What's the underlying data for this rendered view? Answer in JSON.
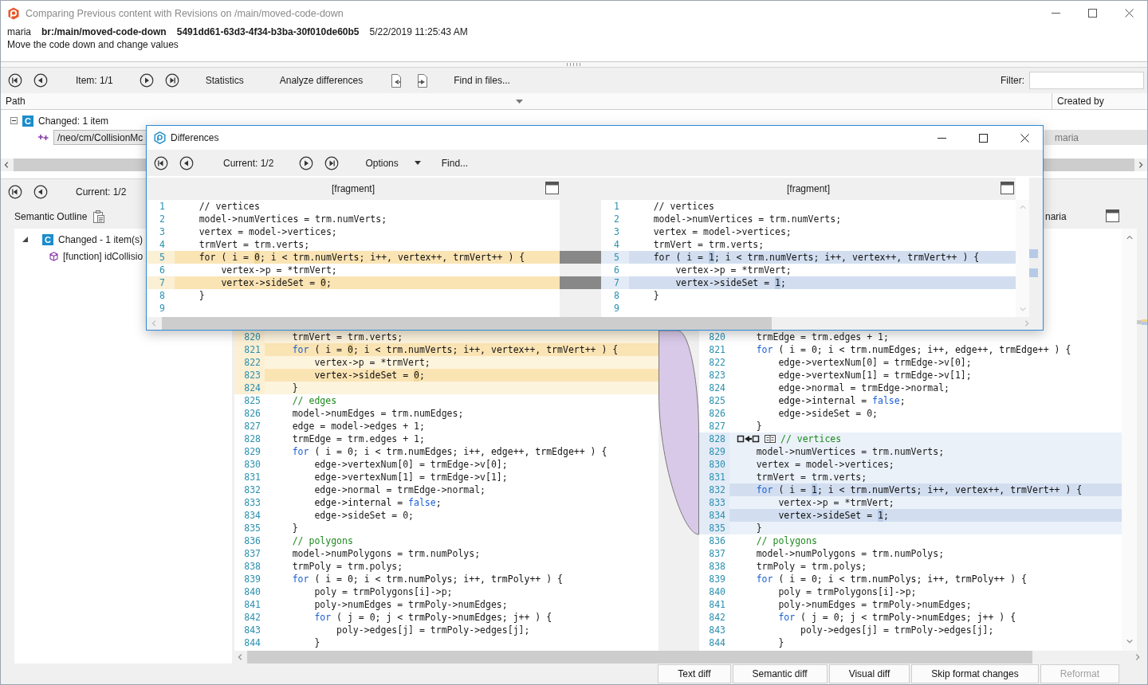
{
  "window": {
    "title": "Comparing Previous content with Revisions on /main/moved-code-down"
  },
  "changeset": {
    "author": "maria",
    "branch": "br:/main/moved-code-down",
    "id": "5491dd61-63d3-4f34-b3ba-30f010de60b5",
    "date": "5/22/2019 11:25:43 AM",
    "comment": "Move the code down and change values"
  },
  "toolbar": {
    "counter": "Item: 1/1",
    "statistics": "Statistics",
    "analyze": "Analyze differences",
    "find": "Find in files...",
    "filter_label": "Filter:"
  },
  "items_table": {
    "columns": [
      "Path",
      "Created by"
    ],
    "groups": [
      {
        "label": "Changed: 1 item",
        "badge": "C",
        "expanded": true,
        "rows": [
          {
            "path": "/neo/cm/CollisionMc",
            "created_by": "maria",
            "selected": true
          }
        ]
      }
    ]
  },
  "diff_toolbar": {
    "counter": "Current: 1/2"
  },
  "semantic_outline": {
    "title": "Semantic Outline",
    "tree": [
      {
        "label": "Changed - 1 item(s)",
        "badge": "C",
        "expanded": true,
        "children": [
          {
            "label": "[function] idCollisio"
          }
        ]
      }
    ]
  },
  "main_diff": {
    "right_header": "naria",
    "panes": [
      {
        "kind": "base",
        "lines": [
          {
            "number": "820",
            "in_block": true,
            "changed": false,
            "text": "    trmVert = trm.verts;"
          },
          {
            "number": "821",
            "in_block": true,
            "changed": true,
            "parts": [
              {
                "text": "    for",
                "kind": "keyword"
              },
              {
                "text": " ( i = ",
                "kind": "code"
              },
              {
                "text": "0",
                "kind": "change"
              },
              {
                "text": "; i < trm.numVerts; i++, vertex++, trmVert++ ) {",
                "kind": "code"
              }
            ]
          },
          {
            "number": "822",
            "in_block": true,
            "changed": false,
            "text": "        vertex->p = *trmVert;"
          },
          {
            "number": "823",
            "in_block": true,
            "changed": true,
            "parts": [
              {
                "text": "        vertex->sideSet = ",
                "kind": "code"
              },
              {
                "text": "0",
                "kind": "change"
              },
              {
                "text": ";",
                "kind": "code"
              }
            ]
          },
          {
            "number": "824",
            "in_block": true,
            "changed": false,
            "text": "    }"
          },
          {
            "number": "825",
            "in_block": false,
            "changed": false,
            "parts": [
              {
                "text": "    // edges",
                "kind": "comment"
              }
            ]
          },
          {
            "number": "826",
            "in_block": false,
            "changed": false,
            "text": "    model->numEdges = trm.numEdges;"
          },
          {
            "number": "827",
            "in_block": false,
            "changed": false,
            "text": "    edge = model->edges + 1;"
          },
          {
            "number": "828",
            "in_block": false,
            "changed": false,
            "text": "    trmEdge = trm.edges + 1;"
          },
          {
            "number": "829",
            "in_block": false,
            "changed": false,
            "parts": [
              {
                "text": "    for",
                "kind": "keyword"
              },
              {
                "text": " ( i = 0; i < trm.numEdges; i++, edge++, trmEdge++ ) {",
                "kind": "code"
              }
            ]
          },
          {
            "number": "830",
            "in_block": false,
            "changed": false,
            "text": "        edge->vertexNum[0] = trmEdge->v[0];"
          },
          {
            "number": "831",
            "in_block": false,
            "changed": false,
            "text": "        edge->vertexNum[1] = trmEdge->v[1];"
          },
          {
            "number": "832",
            "in_block": false,
            "changed": false,
            "text": "        edge->normal = trmEdge->normal;"
          },
          {
            "number": "833",
            "in_block": false,
            "changed": false,
            "parts": [
              {
                "text": "        edge->internal = ",
                "kind": "code"
              },
              {
                "text": "false",
                "kind": "keyword"
              },
              {
                "text": ";",
                "kind": "code"
              }
            ]
          },
          {
            "number": "834",
            "in_block": false,
            "changed": false,
            "text": "        edge->sideSet = 0;"
          },
          {
            "number": "835",
            "in_block": false,
            "changed": false,
            "text": "    }"
          },
          {
            "number": "836",
            "in_block": false,
            "changed": false,
            "parts": [
              {
                "text": "    // polygons",
                "kind": "comment"
              }
            ]
          },
          {
            "number": "837",
            "in_block": false,
            "changed": false,
            "text": "    model->numPolygons = trm.numPolys;"
          },
          {
            "number": "838",
            "in_block": false,
            "changed": false,
            "text": "    trmPoly = trm.polys;"
          },
          {
            "number": "839",
            "in_block": false,
            "changed": false,
            "parts": [
              {
                "text": "    for",
                "kind": "keyword"
              },
              {
                "text": " ( i = 0; i < trm.numPolys; i++, trmPoly++ ) {",
                "kind": "code"
              }
            ]
          },
          {
            "number": "840",
            "in_block": false,
            "changed": false,
            "text": "        poly = trmPolygons[i]->p;"
          },
          {
            "number": "841",
            "in_block": false,
            "changed": false,
            "text": "        poly->numEdges = trmPoly->numEdges;"
          },
          {
            "number": "842",
            "in_block": false,
            "changed": false,
            "parts": [
              {
                "text": "        for",
                "kind": "keyword"
              },
              {
                "text": " ( j = 0; j < trmPoly->numEdges; j++ ) {",
                "kind": "code"
              }
            ]
          },
          {
            "number": "843",
            "in_block": false,
            "changed": false,
            "text": "            poly->edges[j] = trmPoly->edges[j];"
          },
          {
            "number": "844",
            "in_block": false,
            "changed": false,
            "text": "        }"
          }
        ]
      },
      {
        "kind": "revision",
        "lines": [
          {
            "number": "820",
            "in_block": false,
            "changed": false,
            "text": "    trmEdge = trm.edges + 1;"
          },
          {
            "number": "821",
            "in_block": false,
            "changed": false,
            "parts": [
              {
                "text": "    for",
                "kind": "keyword"
              },
              {
                "text": " ( i = 0; i < trm.numEdges; i++, edge++, trmEdge++ ) {",
                "kind": "code"
              }
            ]
          },
          {
            "number": "822",
            "in_block": false,
            "changed": false,
            "text": "        edge->vertexNum[0] = trmEdge->v[0];"
          },
          {
            "number": "823",
            "in_block": false,
            "changed": false,
            "text": "        edge->vertexNum[1] = trmEdge->v[1];"
          },
          {
            "number": "824",
            "in_block": false,
            "changed": false,
            "text": "        edge->normal = trmEdge->normal;"
          },
          {
            "number": "825",
            "in_block": false,
            "changed": false,
            "parts": [
              {
                "text": "        edge->internal = ",
                "kind": "code"
              },
              {
                "text": "false",
                "kind": "keyword"
              },
              {
                "text": ";",
                "kind": "code"
              }
            ]
          },
          {
            "number": "826",
            "in_block": false,
            "changed": false,
            "text": "        edge->sideSet = 0;"
          },
          {
            "number": "827",
            "in_block": false,
            "changed": false,
            "text": "    }"
          },
          {
            "number": "828",
            "in_block": true,
            "changed": false,
            "moved_marker": true,
            "parts": [
              {
                "text": "// vertices",
                "kind": "comment"
              }
            ]
          },
          {
            "number": "829",
            "in_block": true,
            "changed": false,
            "text": "    model->numVertices = trm.numVerts;"
          },
          {
            "number": "830",
            "in_block": true,
            "changed": false,
            "text": "    vertex = model->vertices;"
          },
          {
            "number": "831",
            "in_block": true,
            "changed": false,
            "text": "    trmVert = trm.verts;"
          },
          {
            "number": "832",
            "in_block": true,
            "changed": true,
            "parts": [
              {
                "text": "    for",
                "kind": "keyword"
              },
              {
                "text": " ( i = ",
                "kind": "code"
              },
              {
                "text": "1",
                "kind": "change"
              },
              {
                "text": "; i < trm.numVerts; i++, vertex++, trmVert++ ) {",
                "kind": "code"
              }
            ]
          },
          {
            "number": "833",
            "in_block": true,
            "changed": false,
            "text": "        vertex->p = *trmVert;"
          },
          {
            "number": "834",
            "in_block": true,
            "changed": true,
            "parts": [
              {
                "text": "        vertex->sideSet = ",
                "kind": "code"
              },
              {
                "text": "1",
                "kind": "change"
              },
              {
                "text": ";",
                "kind": "code"
              }
            ]
          },
          {
            "number": "835",
            "in_block": true,
            "changed": false,
            "text": "    }"
          },
          {
            "number": "836",
            "in_block": false,
            "changed": false,
            "parts": [
              {
                "text": "    // polygons",
                "kind": "comment"
              }
            ]
          },
          {
            "number": "837",
            "in_block": false,
            "changed": false,
            "text": "    model->numPolygons = trm.numPolys;"
          },
          {
            "number": "838",
            "in_block": false,
            "changed": false,
            "text": "    trmPoly = trm.polys;"
          },
          {
            "number": "839",
            "in_block": false,
            "changed": false,
            "parts": [
              {
                "text": "    for",
                "kind": "keyword"
              },
              {
                "text": " ( i = 0; i < trm.numPolys; i++, trmPoly++ ) {",
                "kind": "code"
              }
            ]
          },
          {
            "number": "840",
            "in_block": false,
            "changed": false,
            "text": "        poly = trmPolygons[i]->p;"
          },
          {
            "number": "841",
            "in_block": false,
            "changed": false,
            "text": "        poly->numEdges = trmPoly->numEdges;"
          },
          {
            "number": "842",
            "in_block": false,
            "changed": false,
            "parts": [
              {
                "text": "        for",
                "kind": "keyword"
              },
              {
                "text": " ( j = 0; j < trmPoly->numEdges; j++ ) {",
                "kind": "code"
              }
            ]
          },
          {
            "number": "843",
            "in_block": false,
            "changed": false,
            "text": "            poly->edges[j] = trmPoly->edges[j];"
          },
          {
            "number": "844",
            "in_block": false,
            "changed": false,
            "text": "        }"
          }
        ]
      }
    ]
  },
  "bottom_buttons": [
    {
      "label": "Text diff",
      "disabled": false
    },
    {
      "label": "Semantic diff",
      "disabled": false
    },
    {
      "label": "Visual diff",
      "disabled": false
    },
    {
      "label": "Skip format changes",
      "disabled": false
    },
    {
      "label": "Reformat",
      "disabled": true
    }
  ],
  "dialog": {
    "title": "Differences",
    "counter": "Current: 1/2",
    "options": "Options",
    "find": "Find...",
    "panes": [
      {
        "kind": "base",
        "header": "[fragment]",
        "lines": [
          {
            "number": "1",
            "changed": false,
            "text": "    // vertices"
          },
          {
            "number": "2",
            "changed": false,
            "text": "    model->numVertices = trm.numVerts;"
          },
          {
            "number": "3",
            "changed": false,
            "text": "    vertex = model->vertices;"
          },
          {
            "number": "4",
            "changed": false,
            "text": "    trmVert = trm.verts;"
          },
          {
            "number": "5",
            "changed": true,
            "parts": [
              {
                "text": "    for ( i = ",
                "kind": "code"
              },
              {
                "text": "0",
                "kind": "change"
              },
              {
                "text": "; i < trm.numVerts; i++, vertex++, trmVert++ ) {",
                "kind": "code"
              }
            ]
          },
          {
            "number": "6",
            "changed": false,
            "text": "        vertex->p = *trmVert;"
          },
          {
            "number": "7",
            "changed": true,
            "parts": [
              {
                "text": "        vertex->sideSet = ",
                "kind": "code"
              },
              {
                "text": "0",
                "kind": "change"
              },
              {
                "text": ";",
                "kind": "code"
              }
            ]
          },
          {
            "number": "8",
            "changed": false,
            "text": "    }"
          },
          {
            "number": "9",
            "changed": false
          }
        ]
      },
      {
        "kind": "revision",
        "header": "[fragment]",
        "lines": [
          {
            "number": "1",
            "changed": false,
            "text": "    // vertices"
          },
          {
            "number": "2",
            "changed": false,
            "text": "    model->numVertices = trm.numVerts;"
          },
          {
            "number": "3",
            "changed": false,
            "text": "    vertex = model->vertices;"
          },
          {
            "number": "4",
            "changed": false,
            "text": "    trmVert = trm.verts;"
          },
          {
            "number": "5",
            "changed": true,
            "parts": [
              {
                "text": "    for ( i = ",
                "kind": "code"
              },
              {
                "text": "1",
                "kind": "change"
              },
              {
                "text": "; i < trm.numVerts; i++, vertex++, trmVert++ ) {",
                "kind": "code"
              }
            ]
          },
          {
            "number": "6",
            "changed": false,
            "text": "        vertex->p = *trmVert;"
          },
          {
            "number": "7",
            "changed": true,
            "parts": [
              {
                "text": "        vertex->sideSet = ",
                "kind": "code"
              },
              {
                "text": "1",
                "kind": "change"
              },
              {
                "text": ";",
                "kind": "code"
              }
            ]
          },
          {
            "number": "8",
            "changed": false,
            "text": "    }"
          },
          {
            "number": "9",
            "changed": false
          }
        ]
      }
    ]
  }
}
